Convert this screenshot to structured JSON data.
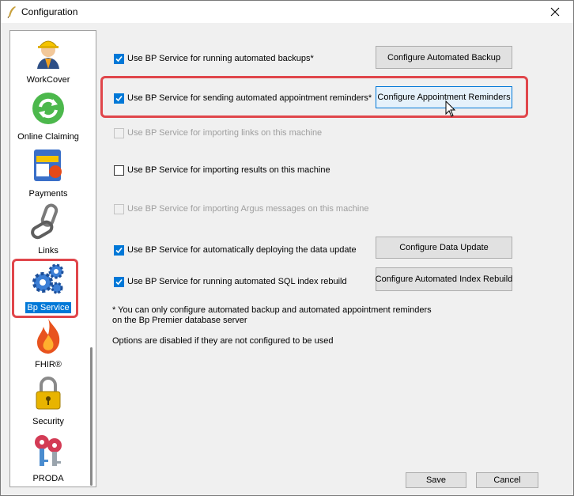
{
  "window": {
    "title": "Configuration"
  },
  "sidebar": {
    "items": [
      {
        "label": "WorkCover",
        "icon": "worker-helmet-icon"
      },
      {
        "label": "Online Claiming",
        "icon": "green-refresh-icon"
      },
      {
        "label": "Payments",
        "icon": "payment-card-icon"
      },
      {
        "label": "Links",
        "icon": "chain-link-icon"
      },
      {
        "label": "Bp Service",
        "icon": "gears-icon",
        "selected": true
      },
      {
        "label": "FHIR®",
        "icon": "flame-icon"
      },
      {
        "label": "Security",
        "icon": "padlock-icon"
      },
      {
        "label": "PRODA",
        "icon": "keys-icon"
      }
    ]
  },
  "options": [
    {
      "label": "Use BP Service for running automated backups*",
      "checked": true,
      "enabled": true,
      "button": "Configure Automated Backup"
    },
    {
      "label": "Use BP Service for sending automated appointment reminders*",
      "checked": true,
      "enabled": true,
      "button": "Configure Appointment Reminders"
    },
    {
      "label": "Use BP Service for importing links on this machine",
      "checked": false,
      "enabled": false
    },
    {
      "label": "Use BP Service for importing results on this machine",
      "checked": false,
      "enabled": true
    },
    {
      "label": "Use BP Service for importing Argus messages on this machine",
      "checked": false,
      "enabled": false
    },
    {
      "label": "Use BP Service for automatically deploying the data update",
      "checked": true,
      "enabled": true,
      "button": "Configure Data Update"
    },
    {
      "label": "Use BP Service for running automated SQL index rebuild",
      "checked": true,
      "enabled": true,
      "button": "Configure Automated Index Rebuild"
    }
  ],
  "notes": {
    "line1": "* You can only configure automated backup and automated appointment reminders",
    "line2": "on the Bp Premier database server",
    "line3": "Options are disabled if they are not configured to be used"
  },
  "footer": {
    "save": "Save",
    "cancel": "Cancel"
  },
  "colors": {
    "accent": "#0078d7",
    "highlight": "#e0464b"
  }
}
